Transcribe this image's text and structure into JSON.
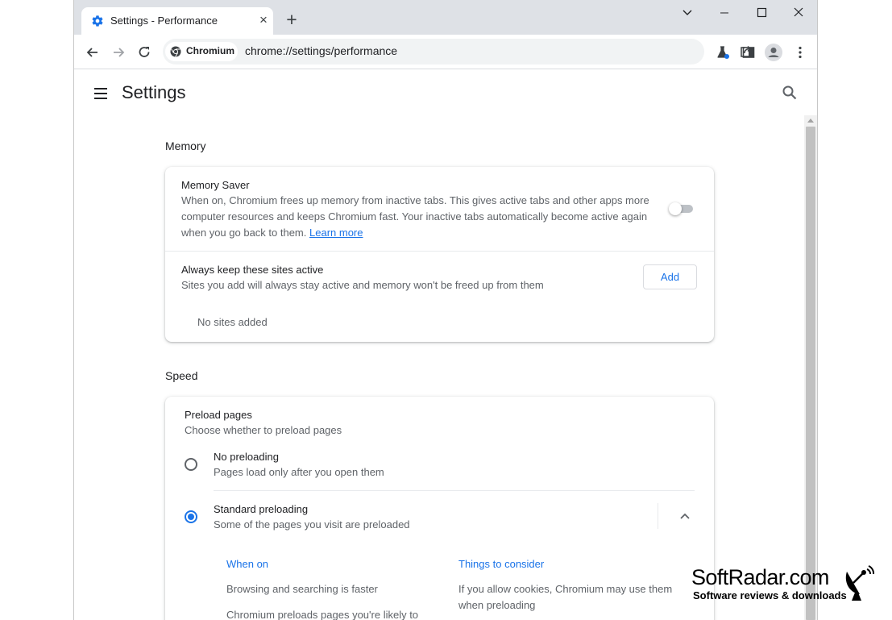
{
  "window": {
    "tab_title": "Settings - Performance",
    "tab_close": "×",
    "new_tab": "+"
  },
  "toolbar": {
    "site_chip": "Chromium",
    "url": "chrome://settings/performance"
  },
  "settings": {
    "title": "Settings"
  },
  "memory": {
    "section_title": "Memory",
    "memory_saver": {
      "title": "Memory Saver",
      "description_line1": "When on, Chromium frees up memory from inactive tabs. This gives active tabs and other apps more",
      "description_line2": "computer resources and keeps Chromium fast. Your inactive tabs automatically become active again",
      "description_line3": "when you go back to them.",
      "learn_more": "Learn more",
      "enabled": false
    },
    "always_active": {
      "title": "Always keep these sites active",
      "description": "Sites you add will always stay active and memory won't be freed up from them",
      "add_label": "Add",
      "empty_text": "No sites added"
    }
  },
  "speed": {
    "section_title": "Speed",
    "preload": {
      "title": "Preload pages",
      "description": "Choose whether to preload pages",
      "options": [
        {
          "label": "No preloading",
          "description": "Pages load only after you open them",
          "selected": false
        },
        {
          "label": "Standard preloading",
          "description": "Some of the pages you visit are preloaded",
          "selected": true
        }
      ],
      "when_on": {
        "heading": "When on",
        "item1": "Browsing and searching is faster",
        "item2": "Chromium preloads pages you're likely to"
      },
      "things_to_consider": {
        "heading": "Things to consider",
        "line1": "If you allow cookies, Chromium may use them",
        "line2": "when preloading"
      }
    }
  },
  "watermark": {
    "title": "SoftRadar.com",
    "subtitle": "Software reviews & downloads"
  },
  "colors": {
    "accent": "#1a73e8",
    "titlebar": "#dee1e6",
    "text": "#202124",
    "secondary_text": "#5f6368"
  }
}
